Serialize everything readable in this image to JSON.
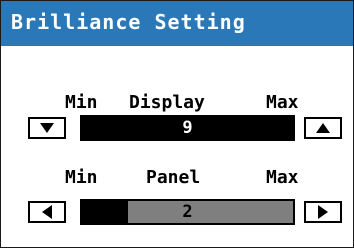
{
  "window": {
    "title": "Brilliance Setting"
  },
  "colors": {
    "titlebar": "#2a78b8",
    "panel_fill": "#7f7f7f"
  },
  "display": {
    "label": "Display",
    "min_label": "Min",
    "max_label": "Max",
    "value": "9",
    "level_fraction": 0,
    "decrease_icon": "triangle-down-icon",
    "increase_icon": "triangle-up-icon"
  },
  "panel": {
    "label": "Panel",
    "min_label": "Min",
    "max_label": "Max",
    "value": "2",
    "level_fraction": 0.78,
    "decrease_icon": "triangle-left-icon",
    "increase_icon": "triangle-right-icon"
  }
}
